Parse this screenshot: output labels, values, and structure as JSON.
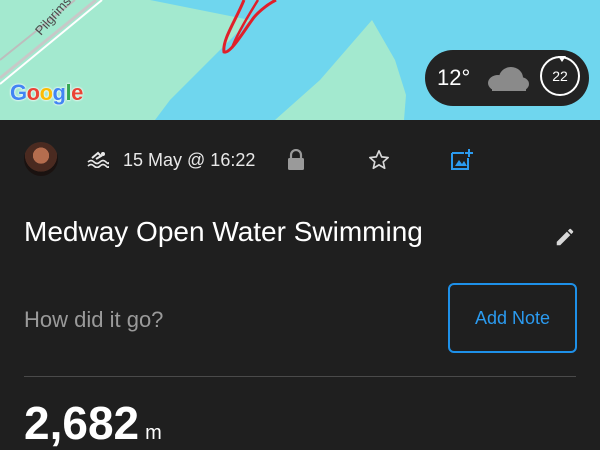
{
  "map": {
    "road_label": "Pilgrims Ra",
    "logo_letters": [
      "G",
      "o",
      "o",
      "g",
      "l",
      "e"
    ],
    "logo_colors": [
      "#4285F4",
      "#EA4335",
      "#FBBC05",
      "#4285F4",
      "#34A853",
      "#EA4335"
    ],
    "water_color": "#6fd6ee",
    "land_color": "#a3e9cf",
    "route_color": "#e0202a"
  },
  "weather": {
    "temperature": "12°",
    "condition_icon": "cloud-icon",
    "time_badge": "22"
  },
  "activity": {
    "date": "15 May @ 16:22",
    "type_icon": "swim-icon",
    "privacy_icon": "lock-icon",
    "favorite_icon": "star-outline-icon",
    "photo_icon": "add-photo-icon",
    "title": "Medway Open Water Swimming",
    "note_prompt": "How did it go?",
    "add_note_label": "Add Note",
    "distance_value": "2,682",
    "distance_unit": "m"
  },
  "colors": {
    "background": "#1f1f1f",
    "accent": "#1e90e8",
    "text_primary": "#ffffff",
    "text_secondary": "#9a9a9a"
  }
}
